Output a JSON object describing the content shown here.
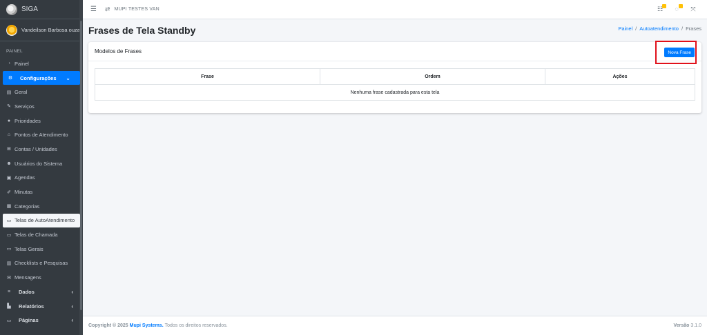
{
  "brand": {
    "name": "SIGA"
  },
  "user": {
    "name": "Vandeilson Barbosa ouza"
  },
  "sidebar": {
    "header": "PAINEL",
    "items": [
      {
        "label": "Painel",
        "icon": "dashboard-icon"
      },
      {
        "label": "Configurações",
        "icon": "cogs-icon"
      },
      {
        "label": "Geral",
        "icon": "printer-icon"
      },
      {
        "label": "Serviços",
        "icon": "wrench-icon"
      },
      {
        "label": "Prioridades",
        "icon": "circle-icon"
      },
      {
        "label": "Pontos de Atendimento",
        "icon": "home-icon"
      },
      {
        "label": "Contas / Unidades",
        "icon": "sitemap-icon"
      },
      {
        "label": "Usuários do Sistema",
        "icon": "users-icon"
      },
      {
        "label": "Agendas",
        "icon": "calendar-icon"
      },
      {
        "label": "Minutas",
        "icon": "edit-icon"
      },
      {
        "label": "Categorias",
        "icon": "list-icon"
      },
      {
        "label": "Telas de AutoAtendimento",
        "icon": "desktop-icon"
      },
      {
        "label": "Telas de Chamada",
        "icon": "desktop-icon"
      },
      {
        "label": "Telas Gerais",
        "icon": "desktop-icon"
      },
      {
        "label": "Checklists e Pesquisas",
        "icon": "id-card-icon"
      },
      {
        "label": "Mensagens",
        "icon": "envelope-icon"
      },
      {
        "label": "Dados",
        "icon": "database-icon"
      },
      {
        "label": "Relatórios",
        "icon": "chart-icon"
      },
      {
        "label": "Páginas",
        "icon": "desktop-icon"
      }
    ]
  },
  "topbar": {
    "org": "MUPI TESTES VAN"
  },
  "page": {
    "title": "Frases de Tela Standby",
    "breadcrumb": [
      "Painel",
      "Autoatendimento",
      "Frases"
    ]
  },
  "card": {
    "title": "Modelos de Frases",
    "new_button": "Nova Frase",
    "columns": [
      "Frase",
      "Ordem",
      "Ações"
    ],
    "empty_message": "Nenhuma frase cadastrada para esta tela"
  },
  "footer": {
    "copyright_prefix": "Copyright © 2025",
    "company": "Mupi Systems.",
    "rights": "Todos os direitos reservados.",
    "version_label": "Versão",
    "version": "3.1.0"
  },
  "colors": {
    "primary": "#007bff",
    "sidebar": "#343a40",
    "highlight": "#e0101a",
    "badge": "#ffc107"
  }
}
